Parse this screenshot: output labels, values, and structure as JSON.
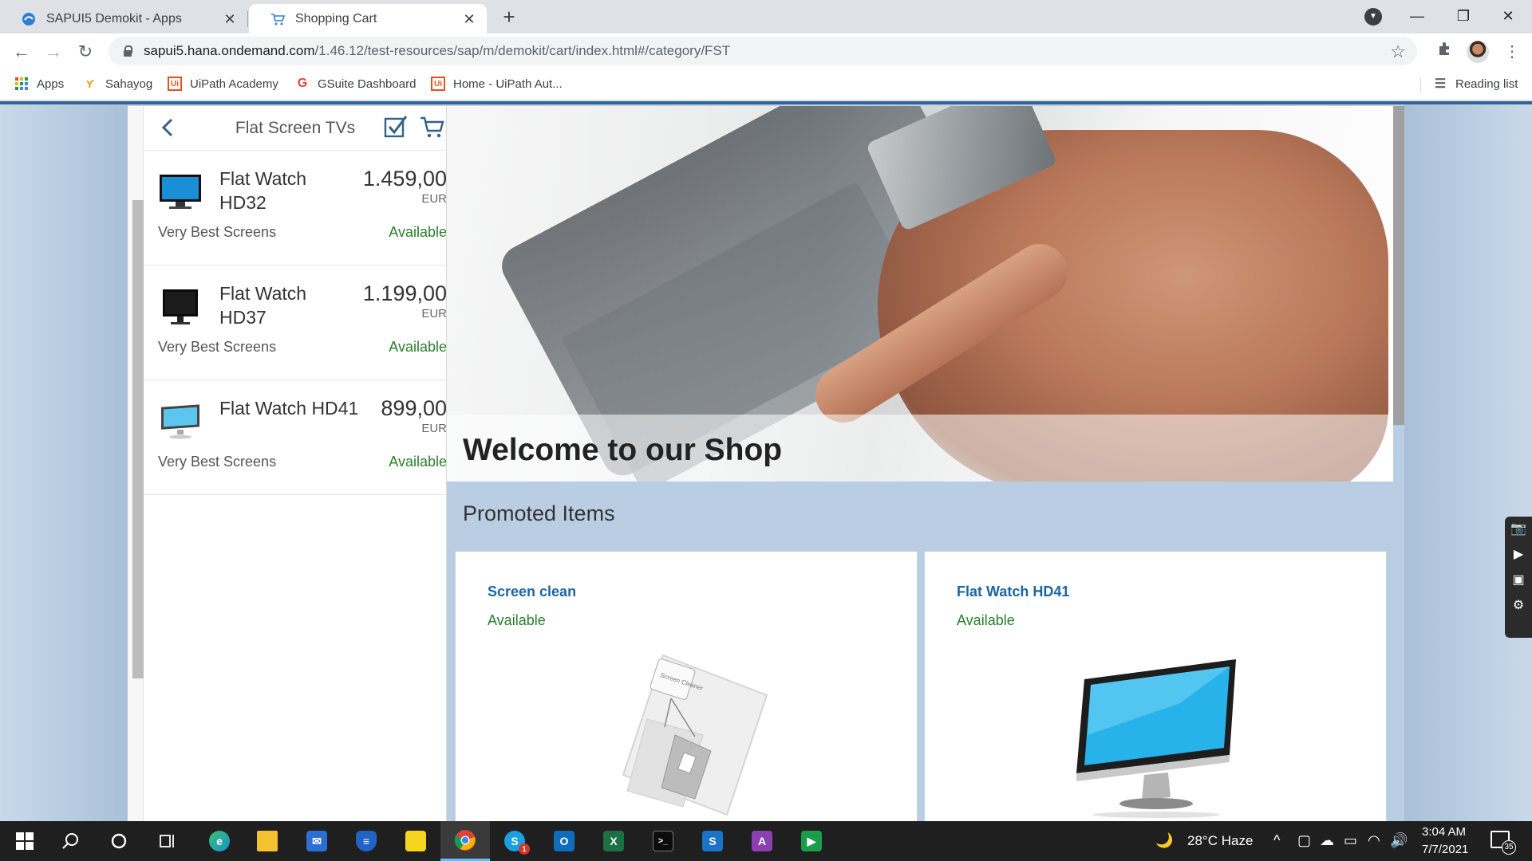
{
  "browser": {
    "tabs": [
      {
        "title": "SAPUI5 Demokit - Apps",
        "active": false
      },
      {
        "title": "Shopping Cart",
        "active": true
      }
    ],
    "url_host": "sapui5.hana.ondemand.com",
    "url_path": "/1.46.12/test-resources/sap/m/demokit/cart/index.html#/category/FST",
    "bookmarks": [
      {
        "label": "Apps"
      },
      {
        "label": "Sahayog"
      },
      {
        "label": "UiPath Academy"
      },
      {
        "label": "GSuite Dashboard"
      },
      {
        "label": "Home - UiPath Aut..."
      }
    ],
    "reading_list": "Reading list",
    "ui_badge": "Ui"
  },
  "master": {
    "title": "Flat Screen TVs",
    "items": [
      {
        "name": "Flat Watch HD32",
        "price": "1.459,00",
        "currency": "EUR",
        "supplier": "Very Best Screens",
        "status": "Available"
      },
      {
        "name": "Flat Watch HD37",
        "price": "1.199,00",
        "currency": "EUR",
        "supplier": "Very Best Screens",
        "status": "Available"
      },
      {
        "name": "Flat Watch HD41",
        "price": "899,00",
        "currency": "EUR",
        "supplier": "Very Best Screens",
        "status": "Available"
      }
    ]
  },
  "detail": {
    "welcome": "Welcome to our Shop",
    "promoted_header": "Promoted Items",
    "promoted": [
      {
        "name": "Screen clean",
        "status": "Available",
        "image_text": "Screen Cleaner"
      },
      {
        "name": "Flat Watch HD41",
        "status": "Available"
      }
    ]
  },
  "taskbar": {
    "weather": "28°C  Haze",
    "time": "3:04 AM",
    "date": "7/7/2021",
    "notifications": "35",
    "skype_badge": "1"
  },
  "colors": {
    "available": "#2b7d2b",
    "link": "#1a66a3",
    "page_bg": "#b9cde3",
    "header_accent": "#356494"
  }
}
